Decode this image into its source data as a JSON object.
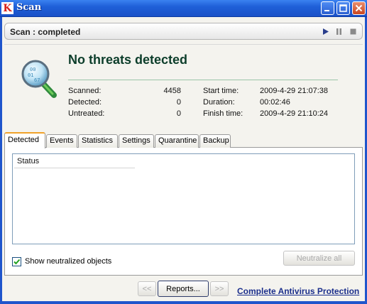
{
  "window": {
    "title": "Scan",
    "app_icon_letter": "K",
    "controls": [
      "minimize-icon",
      "maximize-icon",
      "close-icon"
    ]
  },
  "status": {
    "text": "Scan : completed",
    "controls": [
      "play-icon",
      "pause-icon",
      "stop-icon"
    ]
  },
  "summary": {
    "heading": "No threats detected",
    "stats_left": [
      {
        "label": "Scanned:",
        "value": "4458"
      },
      {
        "label": "Detected:",
        "value": "0"
      },
      {
        "label": "Untreated:",
        "value": "0"
      }
    ],
    "stats_right": [
      {
        "label": "Start time:",
        "value": "2009-4-29 21:07:38"
      },
      {
        "label": "Duration:",
        "value": "00:02:46"
      },
      {
        "label": "Finish time:",
        "value": "2009-4-29 21:10:24"
      }
    ]
  },
  "tabs": [
    {
      "label": "Detected",
      "active": true
    },
    {
      "label": "Events",
      "active": false
    },
    {
      "label": "Statistics",
      "active": false
    },
    {
      "label": "Settings",
      "active": false
    },
    {
      "label": "Quarantine",
      "active": false
    },
    {
      "label": "Backup",
      "active": false
    }
  ],
  "detected_list": {
    "columns": [
      "Status"
    ],
    "rows": []
  },
  "options": {
    "show_neutralized_label": "Show neutralized objects",
    "show_neutralized_checked": true,
    "neutralize_all_label": "Neutralize all",
    "neutralize_all_enabled": false
  },
  "footer": {
    "prev_label": "<<",
    "reports_label": "Reports...",
    "next_label": ">>",
    "product_link": "Complete Antivirus Protection"
  },
  "colors": {
    "titlebar": "#1f5fd8",
    "heading": "#0c3d2a",
    "tab_active_accent": "#f0a22a",
    "link": "#1b2f8c"
  }
}
